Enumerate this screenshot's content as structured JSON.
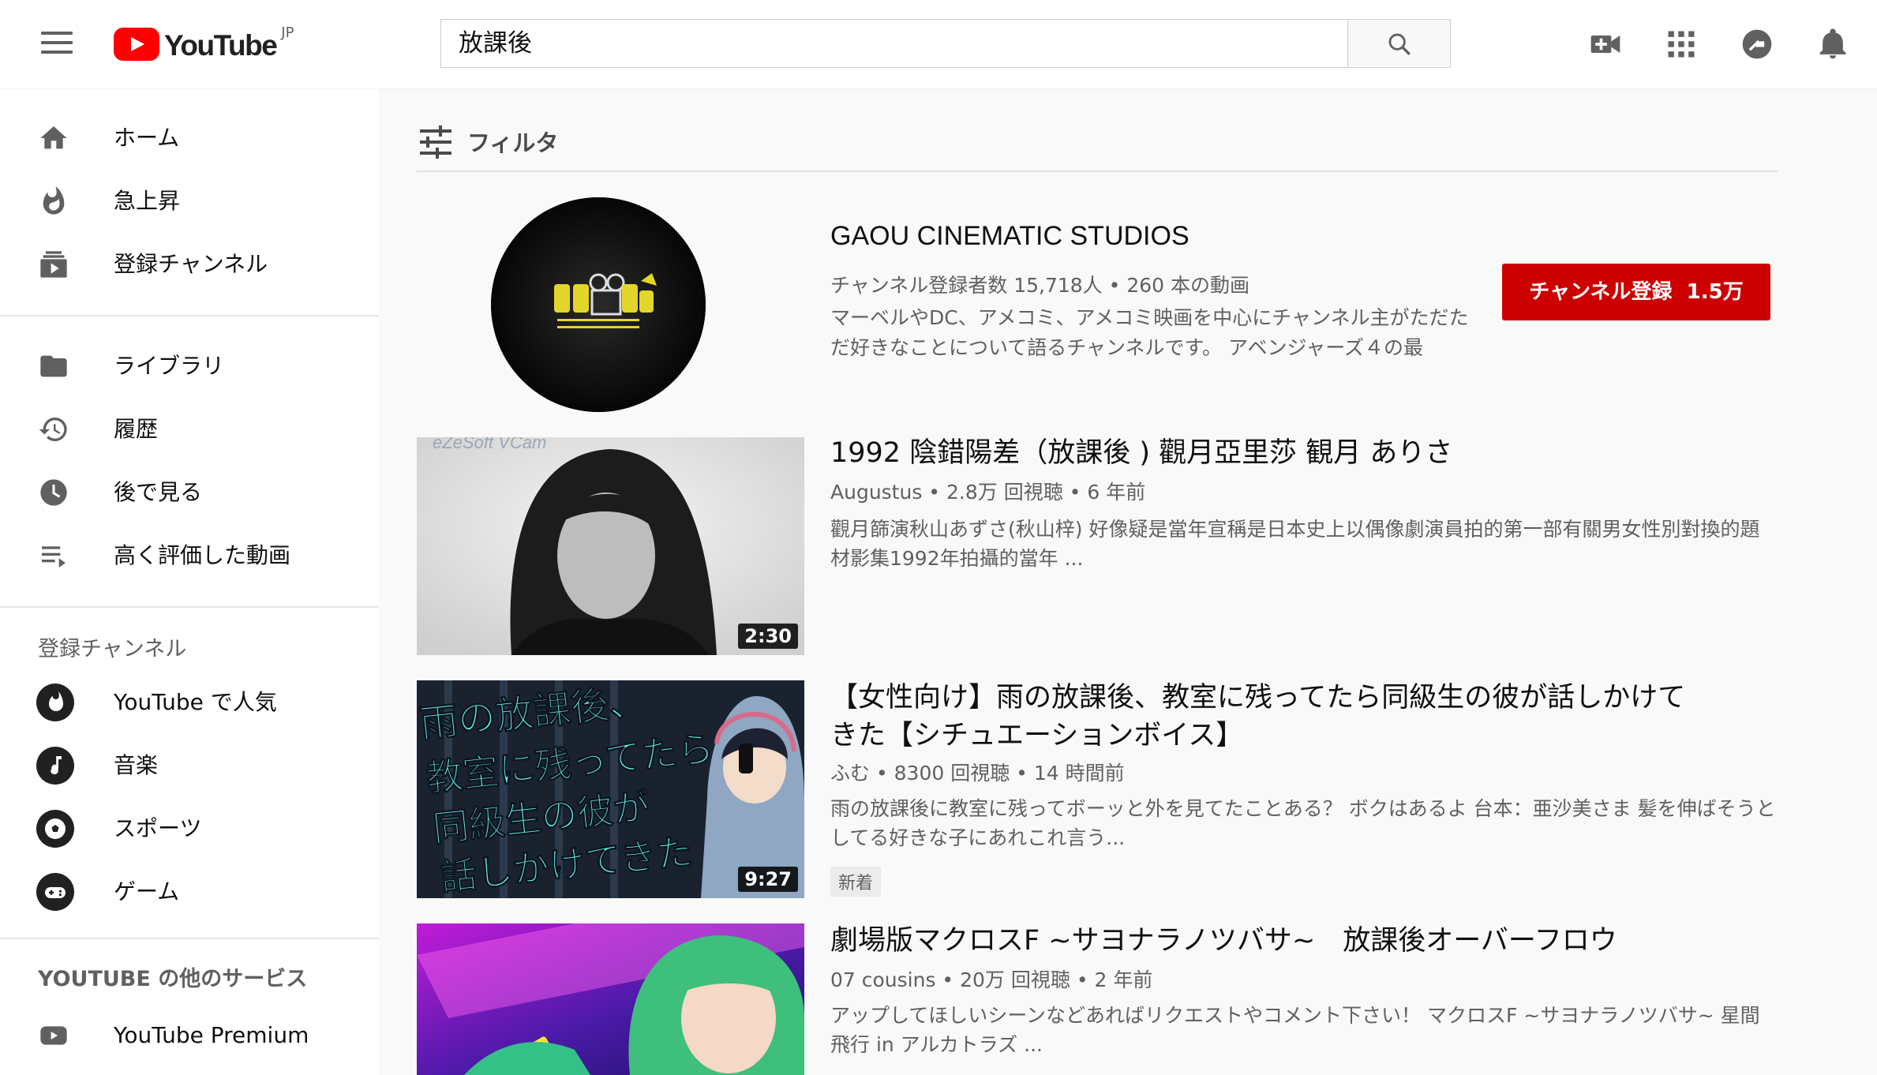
{
  "header": {
    "logo_text": "YouTube",
    "logo_region": "JP",
    "search_value": "放課後"
  },
  "sidebar": {
    "main_items": [
      {
        "label": "ホーム",
        "icon": "home-icon"
      },
      {
        "label": "急上昇",
        "icon": "fire-icon"
      },
      {
        "label": "登録チャンネル",
        "icon": "subscriptions-icon"
      }
    ],
    "library_items": [
      {
        "label": "ライブラリ",
        "icon": "folder-icon"
      },
      {
        "label": "履歴",
        "icon": "history-icon"
      },
      {
        "label": "後で見る",
        "icon": "clock-icon"
      },
      {
        "label": "高く評価した動画",
        "icon": "playlist-icon"
      }
    ],
    "subscriptions_title": "登録チャンネル",
    "subscriptions": [
      {
        "label": "YouTube で人気",
        "icon": "popular-icon"
      },
      {
        "label": "音楽",
        "icon": "music-icon"
      },
      {
        "label": "スポーツ",
        "icon": "sports-icon"
      },
      {
        "label": "ゲーム",
        "icon": "gaming-icon"
      }
    ],
    "more_title": "YOUTUBE の他のサービス",
    "more_items": [
      {
        "label": "YouTube Premium",
        "icon": "premium-icon"
      }
    ]
  },
  "filter_label": "フィルタ",
  "channel": {
    "name": "GAOU CINEMATIC STUDIOS",
    "meta": "チャンネル登録者数 15,718人 • 260 本の動画",
    "description": "マーベルやDC、アメコミ、アメコミ映画を中心にチャンネル主がただただ好きなことについて語るチャンネルです。 アベンジャーズ４の最",
    "subscribe_label": "チャンネル登録",
    "subscribe_count": "1.5万"
  },
  "videos": [
    {
      "title": "1992 陰錯陽差（放課後 ) 觀月亞里莎 観月 ありさ",
      "meta": "Augustus • 2.8万 回視聴 • 6 年前",
      "description": "觀月篩演秋山あずさ(秋山梓) 好像疑是當年宣稱是日本史上以偶像劇演員拍的第一部有關男女性別對換的題材影集1992年拍攝的當年 ...",
      "duration": "2:30",
      "thumb_watermark": "eZeSoft VCam"
    },
    {
      "title": "【女性向け】雨の放課後、教室に残ってたら同級生の彼が話しかけてきた【シチュエーションボイス】",
      "meta": "ふむ • 8300 回視聴 • 14 時間前",
      "description": "雨の放課後に教室に残ってボーッと外を見てたことある？ ボクはあるよ 台本：亜沙美さま 髪を伸ばそうとしてる好きな子にあれこれ言う...",
      "duration": "9:27",
      "badge": "新着",
      "thumb_lines": [
        "雨の放課後、",
        "教室に残ってたら",
        "同級生の彼が",
        "話しかけてきた"
      ]
    },
    {
      "title": "劇場版マクロスF ~サヨナラノツバサ~　放課後オーバーフロウ",
      "meta": "07 cousins • 20万 回視聴 • 2 年前",
      "description": "アップしてほしいシーンなどあればリクエストやコメント下さい！ マクロスF ~サヨナラノツバサ~ 星間飛行 in アルカトラズ ..."
    }
  ],
  "colors": {
    "brand_red": "#ff0000",
    "subscribe_red": "#cc0000"
  }
}
